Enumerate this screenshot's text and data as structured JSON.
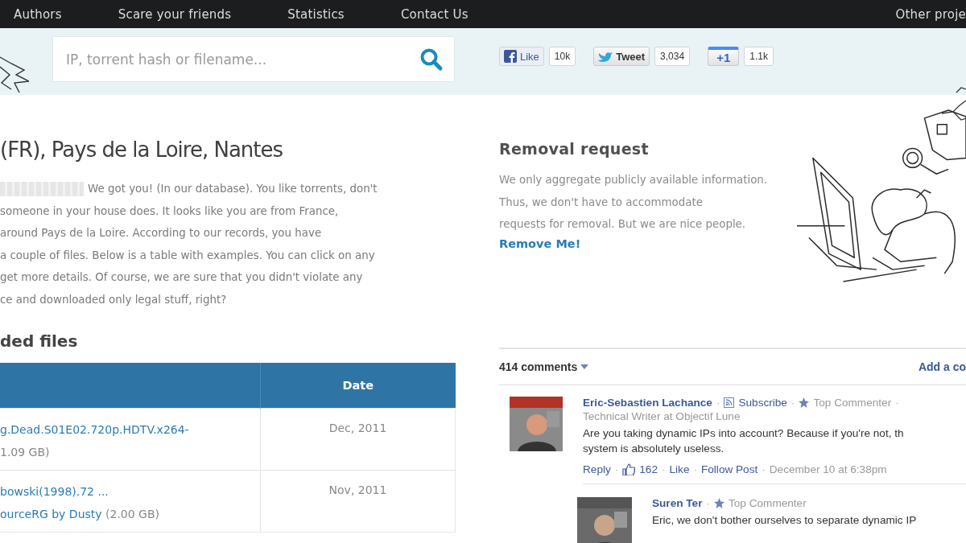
{
  "nav": {
    "items": [
      {
        "label": "Authors"
      },
      {
        "label": "Scare your friends"
      },
      {
        "label": "Statistics"
      },
      {
        "label": "Contact Us"
      }
    ],
    "right_item": "Other proje"
  },
  "search": {
    "placeholder": "IP, torrent hash or filename..."
  },
  "social": [
    {
      "kind": "facebook",
      "label": "Like",
      "count": "10k"
    },
    {
      "kind": "twitter",
      "label": "Tweet",
      "count": "3,034"
    },
    {
      "kind": "google",
      "label": "+1",
      "count": "1.1k"
    }
  ],
  "location_title": "(FR), Pays de la Loire, Nantes",
  "intro_lines": [
    "We got you! (In our database). You like torrents, don't",
    "someone in your house does. It looks like you are from France,",
    "around Pays de la Loire. According to our records, you have",
    "a couple of files. Below is a table with examples. You can click on any",
    "get more details. Of course, we are sure that you didn't violate any",
    "ce and downloaded only legal stuff, right?"
  ],
  "files_heading": "ded files",
  "table": {
    "date_header": "Date",
    "rows": [
      {
        "lines": [
          [
            {
              "kind": "link",
              "text": "g.Dead.S01E02.720p.HDTV.x264-"
            }
          ],
          [
            {
              "kind": "size",
              "text": "1.09 GB)"
            }
          ]
        ],
        "date": "Dec, 2011"
      },
      {
        "lines": [
          [
            {
              "kind": "link",
              "text": "bowski(1998).72 ..."
            }
          ],
          [
            {
              "kind": "link",
              "text": "ourceRG by Dusty"
            },
            {
              "kind": "size",
              "text": "(2.00 GB)"
            }
          ]
        ],
        "date": "Nov, 2011"
      }
    ]
  },
  "removal": {
    "title": "Removal request",
    "lines": [
      "We only aggregate publicly available information.",
      "Thus, we don't have to accommodate",
      "requests for removal. But we are nice people."
    ],
    "link": "Remove Me!"
  },
  "comments": {
    "count": "414 comments",
    "add_link": "Add a co",
    "separator": "·",
    "items": [
      {
        "author": "Eric-Sebastien Lachance",
        "subscribe": "Subscribe",
        "badge": "Top Commenter",
        "job": "Technical Writer at Objectif Lune",
        "lines": [
          "Are you taking dynamic IPs into account? Because if you're not, th",
          "system is absolutely useless."
        ],
        "reply": "Reply",
        "likes": "162",
        "like": "Like",
        "follow": "Follow Post",
        "time": "December 10 at 6:38pm"
      },
      {
        "author": "Suren Ter",
        "badge": "Top Commenter",
        "lines": [
          "Eric, we don't bother ourselves to separate dynamic IP"
        ]
      }
    ]
  }
}
